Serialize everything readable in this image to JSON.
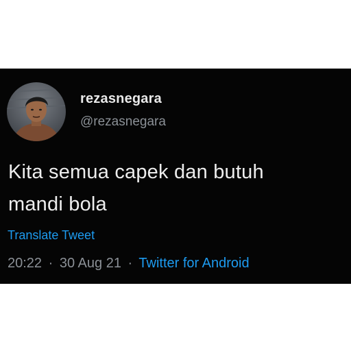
{
  "tweet": {
    "display_name": "rezasnegara",
    "handle": "@rezasnegara",
    "text_line1": "Kita semua capek dan butuh",
    "text_line2": "mandi bola",
    "translate_label": "Translate Tweet",
    "time": "20:22",
    "date": "30 Aug 21",
    "separator": "·",
    "source": "Twitter for Android"
  },
  "colors": {
    "card_background": "#050505",
    "text_primary": "#ededed",
    "text_secondary": "#8b9096",
    "accent_blue": "#1d9bf0"
  },
  "icons": {
    "avatar": "profile-photo"
  }
}
